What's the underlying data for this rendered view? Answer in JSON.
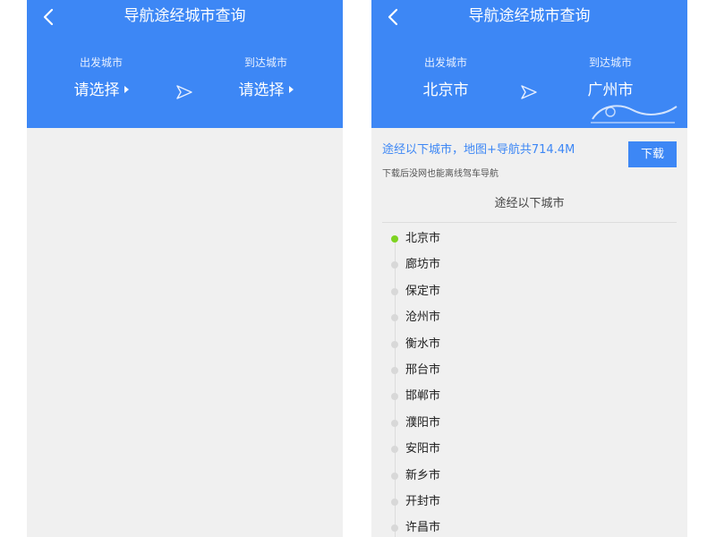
{
  "left_screen": {
    "title": "导航途经城市查询",
    "origin_label": "出发城市",
    "origin_value": "请选择",
    "destination_label": "到达城市",
    "destination_value": "请选择"
  },
  "right_screen": {
    "title": "导航途经城市查询",
    "origin_label": "出发城市",
    "origin_value": "北京市",
    "destination_label": "到达城市",
    "destination_value": "广州市",
    "summary": "途经以下城市，地图+导航共714.4M",
    "download_label": "下载",
    "offline_note": "下载后没网也能离线驾车导航",
    "section_title": "途经以下城市",
    "cities": [
      "北京市",
      "廊坊市",
      "保定市",
      "沧州市",
      "衡水市",
      "邢台市",
      "邯郸市",
      "濮阳市",
      "安阳市",
      "新乡市",
      "开封市",
      "许昌市"
    ]
  },
  "colors": {
    "header": "#3d87f5",
    "accent": "#3d87f5",
    "active_dot": "#7ed321",
    "inactive_dot": "#d8d8d8",
    "background": "#f0f0f0"
  },
  "icons": {
    "back": "chevron-left-icon",
    "send": "send-icon",
    "caret": "triangle-right-icon"
  }
}
